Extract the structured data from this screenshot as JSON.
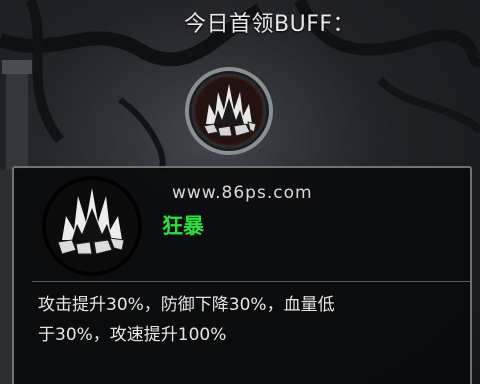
{
  "title": "今日首领BUFF：",
  "watermark": "www.86ps.com",
  "buff": {
    "name": "狂暴",
    "description": "攻击提升30%，防御下降30%，血量低\n于30%，攻速提升100%",
    "name_color": "#29e23a",
    "icon": "explosion-burst-icon"
  },
  "colors": {
    "panel_border": "#6f7276",
    "text": "#e6e6e6"
  }
}
